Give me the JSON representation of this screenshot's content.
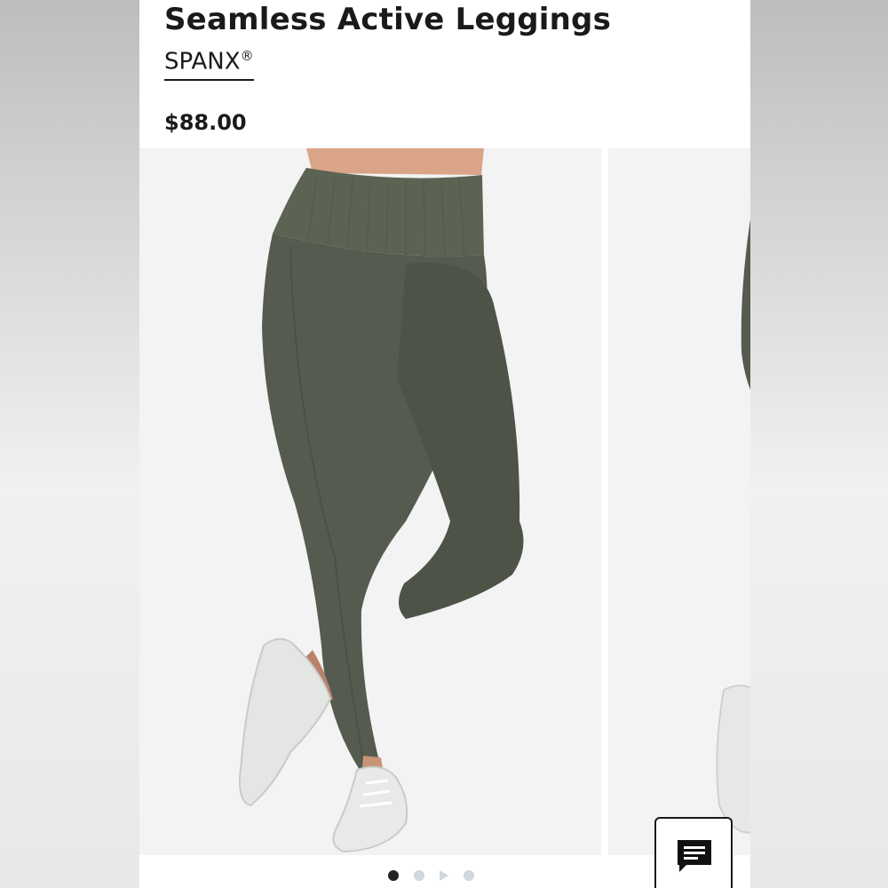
{
  "product": {
    "title": "Seamless Active Leggings",
    "brand": "SPANX",
    "brand_mark": "®",
    "price": "$88.00"
  },
  "carousel": {
    "total_slides": 4,
    "active_index": 0,
    "slides": [
      {
        "type": "image",
        "subject": "dark olive seamless leggings with white sneakers"
      },
      {
        "type": "image",
        "subject": "leggings side view (partially visible)"
      },
      {
        "type": "video"
      },
      {
        "type": "image"
      }
    ]
  },
  "colors": {
    "leggings": "#555b4e",
    "text": "#1a1a1a",
    "dot_active": "#222222",
    "dot_inactive": "#cfd8dc",
    "slide_bg": "#f3f3f3"
  },
  "icons": {
    "chat": "chat-bubble-icon",
    "play": "play-icon"
  }
}
